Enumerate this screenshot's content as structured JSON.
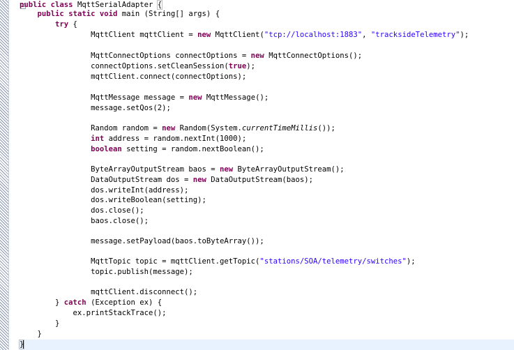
{
  "code": {
    "L1": {
      "kw1": "public",
      "kw2": "class",
      "name": "MqttSerialAdapter",
      "brace": "{"
    },
    "L2": {
      "kw1": "public",
      "kw2": "static",
      "kw3": "void",
      "rest": " main (String[] args) {"
    },
    "L3": {
      "kw": "try",
      "rest": " {"
    },
    "L4": {
      "a": "MqttClient mqttClient = ",
      "kw": "new",
      "b": " MqttClient(",
      "s1": "\"tcp://localhost:1883\"",
      "c": ", ",
      "s2": "\"tracksideTelemetry\"",
      "d": ");"
    },
    "L6": {
      "a": "MqttConnectOptions connectOptions = ",
      "kw": "new",
      "b": " MqttConnectOptions();"
    },
    "L7": {
      "a": "connectOptions.setCleanSession(",
      "kw": "true",
      "b": ");"
    },
    "L8": {
      "a": "mqttClient.connect(connectOptions);"
    },
    "L10": {
      "a": "MqttMessage message = ",
      "kw": "new",
      "b": " MqttMessage();"
    },
    "L11": {
      "a": "message.setQos(2);"
    },
    "L13": {
      "a": "Random random = ",
      "kw": "new",
      "b": " Random(System.",
      "it": "currentTimeMillis",
      "c": "());"
    },
    "L14": {
      "kw": "int",
      "a": " address = random.nextInt(1000);"
    },
    "L15": {
      "kw": "boolean",
      "a": " setting = random.nextBoolean();"
    },
    "L17": {
      "a": "ByteArrayOutputStream baos = ",
      "kw": "new",
      "b": " ByteArrayOutputStream();"
    },
    "L18": {
      "a": "DataOutputStream dos = ",
      "kw": "new",
      "b": " DataOutputStream(baos);"
    },
    "L19": {
      "a": "dos.writeInt(address);"
    },
    "L20": {
      "a": "dos.writeBoolean(setting);"
    },
    "L21": {
      "a": "dos.close();"
    },
    "L22": {
      "a": "baos.close();"
    },
    "L24": {
      "a": "message.setPayload(baos.toByteArray());"
    },
    "L26": {
      "a": "MqttTopic topic = mqttClient.getTopic(",
      "s": "\"stations/SOA/telemetry/switches\"",
      "b": ");"
    },
    "L27": {
      "a": "topic.publish(message);"
    },
    "L29": {
      "a": "mqttClient.disconnect();"
    },
    "L30": {
      "a": "} ",
      "kw": "catch",
      "b": " (Exception ex) {"
    },
    "L31": {
      "a": "ex.printStackTrace();"
    },
    "L32": {
      "a": "}"
    },
    "L33": {
      "a": "}"
    },
    "L34": {
      "a": "}"
    }
  }
}
